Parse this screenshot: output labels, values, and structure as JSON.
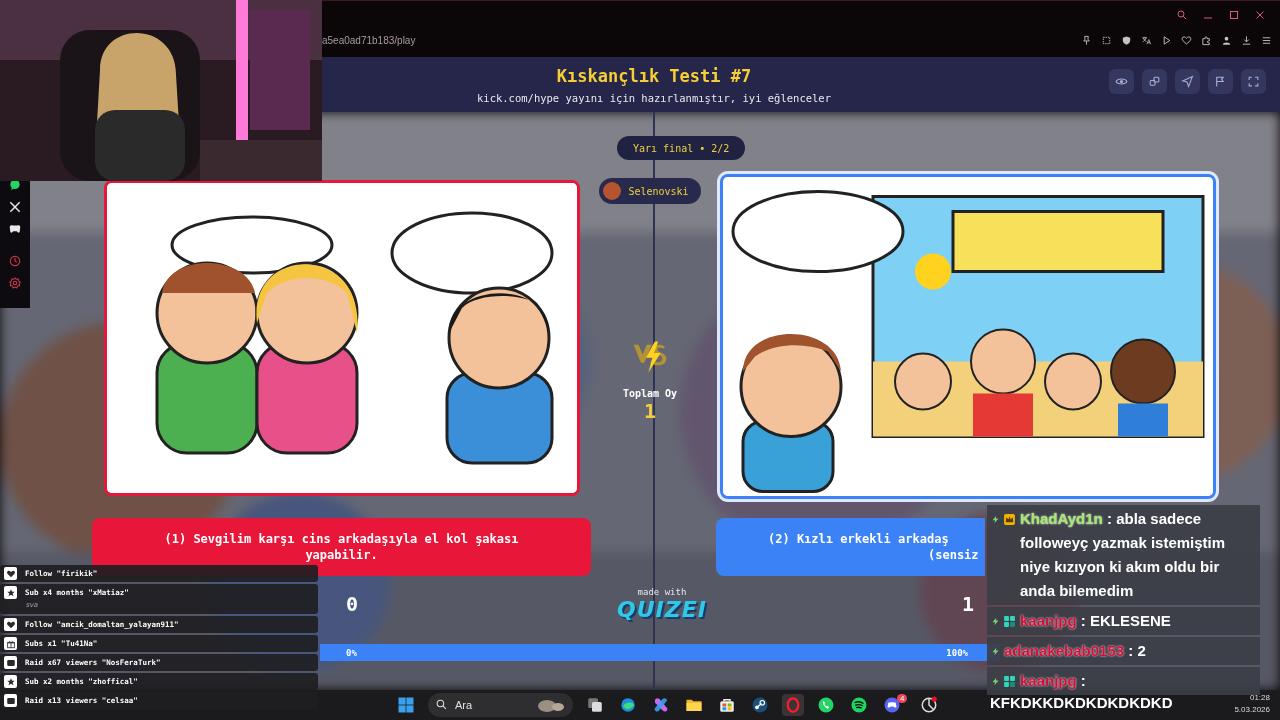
{
  "browser": {
    "url": "a5ea0ad71b183/play"
  },
  "quiz": {
    "title": "Kıskançlık Testi #7",
    "subtitle": "kick.com/hype yayını için hazırlanmıştır, iyi eğlenceler",
    "round": "Yarı final • 2/2",
    "player": "Selenovski",
    "total_label": "Toplam Oy",
    "total": "1",
    "made_with": "made with",
    "logo": "QUIZEI",
    "options": [
      {
        "lines": [
          "(1) Sevgilim karşı cins arkadaşıyla el kol şakası",
          "yapabilir."
        ],
        "color": "#e8173a",
        "selected": false,
        "votes": "0",
        "percent": "0%",
        "level": 0
      },
      {
        "lines": [
          "(2) Kızlı erkekli arkadaş",
          "(sensiz"
        ],
        "color": "#3b82f6",
        "selected": true,
        "votes": "1",
        "percent": "100%",
        "level": 1
      }
    ]
  },
  "alerts": [
    {
      "kind": "follow",
      "text": "Follow \"firikik\""
    },
    {
      "kind": "sub",
      "text": "Sub x4 months \"xMatiaz\"",
      "note": "sva"
    },
    {
      "kind": "follow",
      "text": "Follow \"amcik_domaltan_yalayan911\""
    },
    {
      "kind": "gift",
      "text": "Subs x1 \"Tu41Na\""
    },
    {
      "kind": "raid",
      "text": "Raid x67 viewers \"NosFeraTurk\""
    },
    {
      "kind": "sub",
      "text": "Sub x2 months \"zhoffical\""
    },
    {
      "kind": "raid",
      "text": "Raid x13 viewers \"celsaa\""
    }
  ],
  "chat": [
    {
      "kind": "crown",
      "user": "KhadAyd1n",
      "color": "#a3e86a",
      "text": ": abla sadece followeyç yazmak istemiştim niye kızıyon ki akım oldu bir anda bilemedim"
    },
    {
      "kind": "og",
      "user": "kaanjpg",
      "color": "#d0103a",
      "text": ": EKLESENE"
    },
    {
      "kind": "plain",
      "user": "adanakebab0153",
      "color": "#d0103a",
      "text": ": 2"
    },
    {
      "kind": "og",
      "user": "kaanjpg",
      "color": "#d0103a",
      "text": ":"
    }
  ],
  "last_message": "KFKDKKDKDKDKDKDKD",
  "taskbar": {
    "search_placeholder": "Ara",
    "discord_badge": "4",
    "time": "01:28",
    "date": "5.03.2026"
  }
}
